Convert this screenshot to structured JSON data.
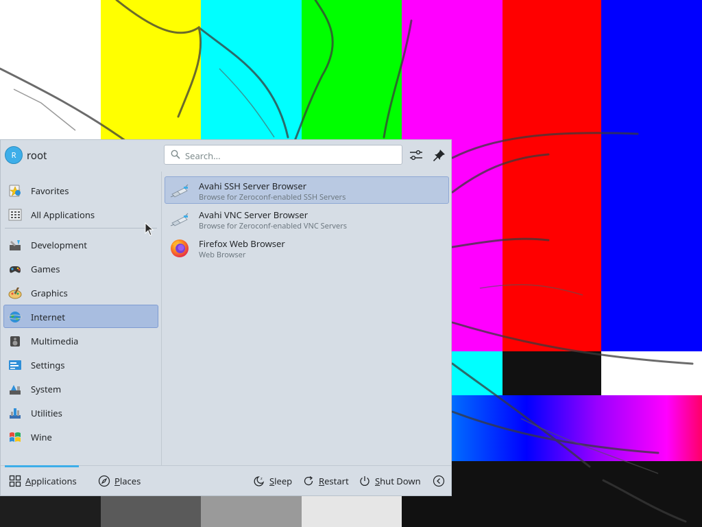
{
  "user": {
    "initial": "R",
    "name": "root"
  },
  "search": {
    "placeholder": "Search...",
    "value": ""
  },
  "header_buttons": [
    {
      "name": "configure",
      "icon": "sliders-icon"
    },
    {
      "name": "pin",
      "icon": "pin-icon"
    }
  ],
  "sidebar": {
    "items": [
      {
        "label": "Favorites",
        "icon": "favorites-icon",
        "active": false
      },
      {
        "label": "All Applications",
        "icon": "all-applications-icon",
        "active": false
      },
      {
        "label": "Development",
        "icon": "development-icon",
        "active": false
      },
      {
        "label": "Games",
        "icon": "games-icon",
        "active": false
      },
      {
        "label": "Graphics",
        "icon": "graphics-icon",
        "active": false
      },
      {
        "label": "Internet",
        "icon": "internet-icon",
        "active": true
      },
      {
        "label": "Multimedia",
        "icon": "multimedia-icon",
        "active": false
      },
      {
        "label": "Settings",
        "icon": "settings-icon",
        "active": false
      },
      {
        "label": "System",
        "icon": "system-icon",
        "active": false
      },
      {
        "label": "Utilities",
        "icon": "utilities-icon",
        "active": false
      },
      {
        "label": "Wine",
        "icon": "wine-icon",
        "active": false
      }
    ]
  },
  "apps": [
    {
      "name": "Avahi SSH Server Browser",
      "description": "Browse for Zeroconf-enabled SSH Servers",
      "icon": "network-plug-icon",
      "highlighted": true
    },
    {
      "name": "Avahi VNC Server Browser",
      "description": "Browse for Zeroconf-enabled VNC Servers",
      "icon": "network-plug-icon",
      "highlighted": false
    },
    {
      "name": "Firefox Web Browser",
      "description": "Web Browser",
      "icon": "firefox-icon",
      "highlighted": false
    }
  ],
  "footer": {
    "tabs": [
      {
        "label": "Applications",
        "mnemonic": "A",
        "icon": "grid-icon",
        "active": true
      },
      {
        "label": "Places",
        "mnemonic": "P",
        "icon": "compass-icon",
        "active": false
      }
    ],
    "actions": [
      {
        "label": "Sleep",
        "mnemonic": "S",
        "icon": "sleep-icon"
      },
      {
        "label": "Restart",
        "mnemonic": "R",
        "icon": "restart-icon"
      },
      {
        "label": "Shut Down",
        "mnemonic": "S",
        "icon": "power-icon"
      }
    ],
    "collapse_icon": "chevron-left-icon"
  },
  "colors": {
    "panel_bg": "#d6dde5",
    "selection_bg": "#a8bde0",
    "hover_bg": "#b9c9e2",
    "accent": "#3daee9",
    "text": "#232629",
    "subtext": "#6d7880"
  }
}
